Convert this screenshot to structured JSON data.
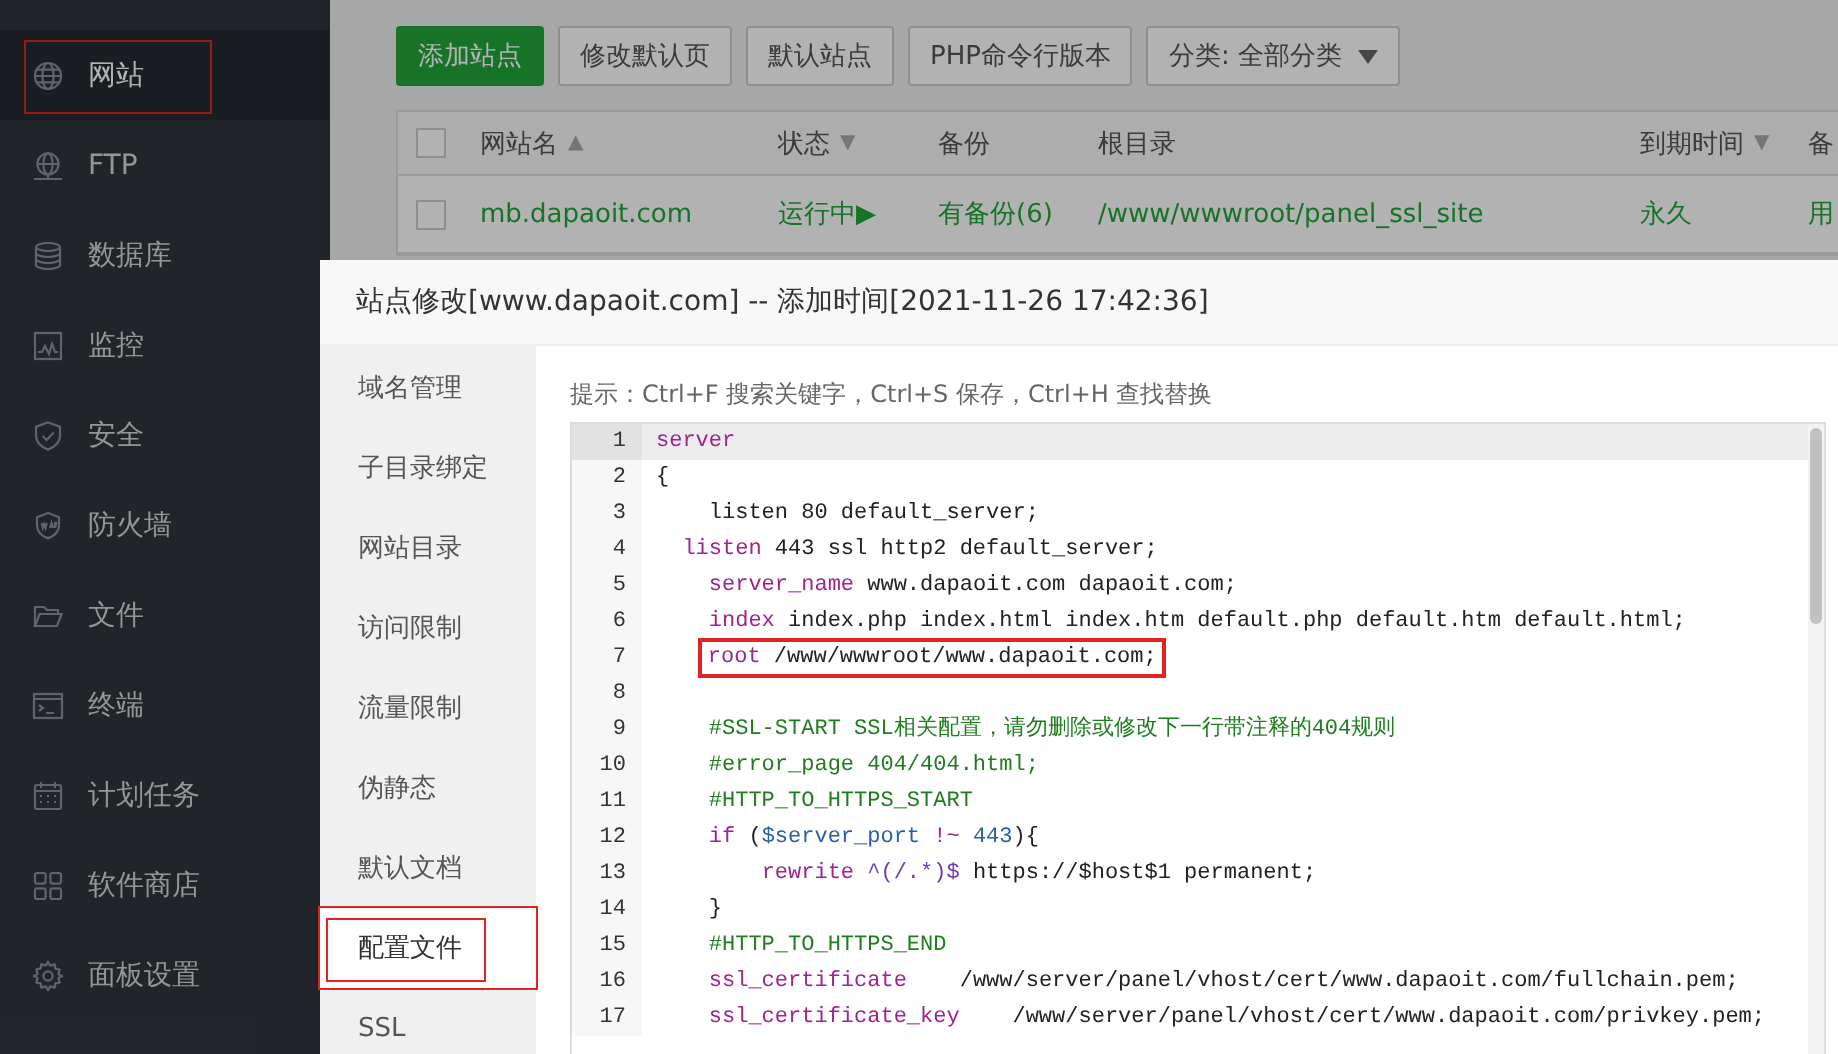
{
  "sidebar": {
    "items": [
      {
        "label": "网站",
        "selected": true,
        "annotated": true
      },
      {
        "label": "FTP",
        "selected": false,
        "annotated": false
      },
      {
        "label": "数据库",
        "selected": false,
        "annotated": false
      },
      {
        "label": "监控",
        "selected": false,
        "annotated": false
      },
      {
        "label": "安全",
        "selected": false,
        "annotated": false
      },
      {
        "label": "防火墙",
        "selected": false,
        "annotated": false
      },
      {
        "label": "文件",
        "selected": false,
        "annotated": false
      },
      {
        "label": "终端",
        "selected": false,
        "annotated": false
      },
      {
        "label": "计划任务",
        "selected": false,
        "annotated": false
      },
      {
        "label": "软件商店",
        "selected": false,
        "annotated": false
      },
      {
        "label": "面板设置",
        "selected": false,
        "annotated": false
      }
    ]
  },
  "toolbar": {
    "buttons": [
      {
        "label": "添加站点",
        "kind": "primary"
      },
      {
        "label": "修改默认页",
        "kind": "default"
      },
      {
        "label": "默认站点",
        "kind": "default"
      },
      {
        "label": "PHP命令行版本",
        "kind": "default"
      },
      {
        "label": "分类: 全部分类",
        "kind": "dropdown"
      }
    ]
  },
  "table": {
    "all_checked": false,
    "columns": [
      {
        "label": "网站名",
        "sort_arrow": "▲"
      },
      {
        "label": "状态",
        "sort_arrow": "▼"
      },
      {
        "label": "备份"
      },
      {
        "label": "根目录"
      },
      {
        "label": "到期时间",
        "sort_arrow": "▼"
      },
      {
        "label": "备"
      }
    ],
    "rows": [
      {
        "checked": false,
        "cells": [
          "mb.dapaoit.com",
          "运行中▶",
          "有备份(6)",
          "/www/wwwroot/panel_ssl_site",
          "永久",
          "用"
        ]
      }
    ]
  },
  "dialog": {
    "title": "站点修改[www.dapaoit.com] -- 添加时间[2021-11-26 17:42:36]",
    "tabs": [
      {
        "label": "域名管理",
        "selected": false,
        "annotated": false
      },
      {
        "label": "子目录绑定",
        "selected": false,
        "annotated": false
      },
      {
        "label": "网站目录",
        "selected": false,
        "annotated": false
      },
      {
        "label": "访问限制",
        "selected": false,
        "annotated": false
      },
      {
        "label": "流量限制",
        "selected": false,
        "annotated": false
      },
      {
        "label": "伪静态",
        "selected": false,
        "annotated": false
      },
      {
        "label": "默认文档",
        "selected": false,
        "annotated": false
      },
      {
        "label": "配置文件",
        "selected": true,
        "annotated": true
      },
      {
        "label": "SSL",
        "selected": false,
        "annotated": false
      }
    ],
    "hint": "提示：Ctrl+F 搜索关键字，Ctrl+S 保存，Ctrl+H 查找替换",
    "editor": {
      "lines": [
        {
          "number": "1",
          "active": true,
          "annotated": false,
          "tokens": [
            {
              "kind": "keyword",
              "text": "server"
            }
          ]
        },
        {
          "number": "2",
          "active": false,
          "annotated": false,
          "tokens": [
            {
              "kind": "plain",
              "text": "{"
            }
          ]
        },
        {
          "number": "3",
          "active": false,
          "annotated": false,
          "tokens": [
            {
              "kind": "plain",
              "text": "    listen 80 default_server;"
            }
          ]
        },
        {
          "number": "4",
          "active": false,
          "annotated": false,
          "tokens": [
            {
              "kind": "keyword",
              "text": "  listen"
            },
            {
              "kind": "plain",
              "text": " 443 ssl http2 default_server;"
            }
          ]
        },
        {
          "number": "5",
          "active": false,
          "annotated": false,
          "tokens": [
            {
              "kind": "keyword",
              "text": "    server_name"
            },
            {
              "kind": "plain",
              "text": " www.dapaoit.com dapaoit.com;"
            }
          ]
        },
        {
          "number": "6",
          "active": false,
          "annotated": false,
          "tokens": [
            {
              "kind": "keyword",
              "text": "    index"
            },
            {
              "kind": "plain",
              "text": " index.php index.html index.htm default.php default.htm default.html;"
            }
          ]
        },
        {
          "number": "7",
          "active": false,
          "annotated": true,
          "tokens": [
            {
              "kind": "keyword",
              "text": "    root"
            },
            {
              "kind": "plain",
              "text": " /www/wwwroot/www.dapaoit.com;"
            }
          ]
        },
        {
          "number": "8",
          "active": false,
          "annotated": false
        },
        {
          "number": "9",
          "active": false,
          "annotated": false,
          "tokens": [
            {
              "kind": "comment",
              "text": "    #SSL-START SSL相关配置，请勿删除或修改下一行带注释的404规则"
            }
          ]
        },
        {
          "number": "10",
          "active": false,
          "annotated": false,
          "tokens": [
            {
              "kind": "comment",
              "text": "    #error_page 404/404.html;"
            }
          ]
        },
        {
          "number": "11",
          "active": false,
          "annotated": false,
          "tokens": [
            {
              "kind": "comment",
              "text": "    #HTTP_TO_HTTPS_START"
            }
          ]
        },
        {
          "number": "12",
          "active": false,
          "annotated": false,
          "tokens": [
            {
              "kind": "keyword",
              "text": "    if"
            },
            {
              "kind": "plain",
              "text": " ("
            },
            {
              "kind": "variable",
              "text": "$server_port"
            },
            {
              "kind": "keyword",
              "text": " !~ "
            },
            {
              "kind": "variable",
              "text": "443"
            },
            {
              "kind": "plain",
              "text": "){"
            }
          ]
        },
        {
          "number": "13",
          "active": false,
          "annotated": false,
          "tokens": [
            {
              "kind": "keyword",
              "text": "        rewrite"
            },
            {
              "kind": "regex",
              "text": " ^(/.*)$"
            },
            {
              "kind": "plain",
              "text": " https://$host$1 permanent;"
            }
          ]
        },
        {
          "number": "14",
          "active": false,
          "annotated": false,
          "tokens": [
            {
              "kind": "plain",
              "text": "    }"
            }
          ]
        },
        {
          "number": "15",
          "active": false,
          "annotated": false,
          "tokens": [
            {
              "kind": "comment",
              "text": "    #HTTP_TO_HTTPS_END"
            }
          ]
        },
        {
          "number": "16",
          "active": false,
          "annotated": false,
          "tokens": [
            {
              "kind": "keyword",
              "text": "    ssl_certificate"
            },
            {
              "kind": "plain",
              "text": "    /www/server/panel/vhost/cert/www.dapaoit.com/fullchain.pem;"
            }
          ]
        },
        {
          "number": "17",
          "active": false,
          "annotated": false,
          "tokens": [
            {
              "kind": "keyword",
              "text": "    ssl_certificate_key"
            },
            {
              "kind": "plain",
              "text": "    /www/server/panel/vhost/cert/www.dapaoit.com/privkey.pem;"
            }
          ]
        }
      ]
    }
  }
}
